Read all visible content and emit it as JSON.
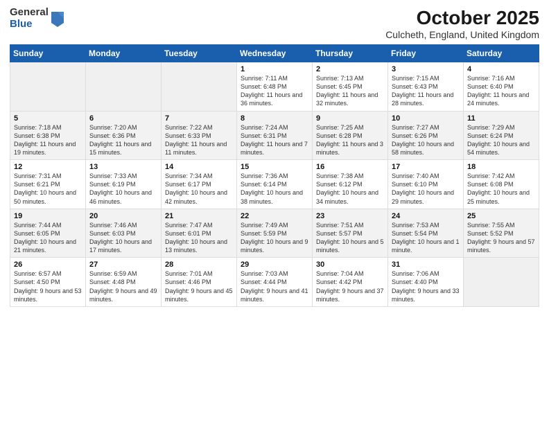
{
  "header": {
    "logo_general": "General",
    "logo_blue": "Blue",
    "title": "October 2025",
    "subtitle": "Culcheth, England, United Kingdom"
  },
  "days_of_week": [
    "Sunday",
    "Monday",
    "Tuesday",
    "Wednesday",
    "Thursday",
    "Friday",
    "Saturday"
  ],
  "weeks": [
    [
      {
        "day": "",
        "sunrise": "",
        "sunset": "",
        "daylight": ""
      },
      {
        "day": "",
        "sunrise": "",
        "sunset": "",
        "daylight": ""
      },
      {
        "day": "",
        "sunrise": "",
        "sunset": "",
        "daylight": ""
      },
      {
        "day": "1",
        "sunrise": "Sunrise: 7:11 AM",
        "sunset": "Sunset: 6:48 PM",
        "daylight": "Daylight: 11 hours and 36 minutes."
      },
      {
        "day": "2",
        "sunrise": "Sunrise: 7:13 AM",
        "sunset": "Sunset: 6:45 PM",
        "daylight": "Daylight: 11 hours and 32 minutes."
      },
      {
        "day": "3",
        "sunrise": "Sunrise: 7:15 AM",
        "sunset": "Sunset: 6:43 PM",
        "daylight": "Daylight: 11 hours and 28 minutes."
      },
      {
        "day": "4",
        "sunrise": "Sunrise: 7:16 AM",
        "sunset": "Sunset: 6:40 PM",
        "daylight": "Daylight: 11 hours and 24 minutes."
      }
    ],
    [
      {
        "day": "5",
        "sunrise": "Sunrise: 7:18 AM",
        "sunset": "Sunset: 6:38 PM",
        "daylight": "Daylight: 11 hours and 19 minutes."
      },
      {
        "day": "6",
        "sunrise": "Sunrise: 7:20 AM",
        "sunset": "Sunset: 6:36 PM",
        "daylight": "Daylight: 11 hours and 15 minutes."
      },
      {
        "day": "7",
        "sunrise": "Sunrise: 7:22 AM",
        "sunset": "Sunset: 6:33 PM",
        "daylight": "Daylight: 11 hours and 11 minutes."
      },
      {
        "day": "8",
        "sunrise": "Sunrise: 7:24 AM",
        "sunset": "Sunset: 6:31 PM",
        "daylight": "Daylight: 11 hours and 7 minutes."
      },
      {
        "day": "9",
        "sunrise": "Sunrise: 7:25 AM",
        "sunset": "Sunset: 6:28 PM",
        "daylight": "Daylight: 11 hours and 3 minutes."
      },
      {
        "day": "10",
        "sunrise": "Sunrise: 7:27 AM",
        "sunset": "Sunset: 6:26 PM",
        "daylight": "Daylight: 10 hours and 58 minutes."
      },
      {
        "day": "11",
        "sunrise": "Sunrise: 7:29 AM",
        "sunset": "Sunset: 6:24 PM",
        "daylight": "Daylight: 10 hours and 54 minutes."
      }
    ],
    [
      {
        "day": "12",
        "sunrise": "Sunrise: 7:31 AM",
        "sunset": "Sunset: 6:21 PM",
        "daylight": "Daylight: 10 hours and 50 minutes."
      },
      {
        "day": "13",
        "sunrise": "Sunrise: 7:33 AM",
        "sunset": "Sunset: 6:19 PM",
        "daylight": "Daylight: 10 hours and 46 minutes."
      },
      {
        "day": "14",
        "sunrise": "Sunrise: 7:34 AM",
        "sunset": "Sunset: 6:17 PM",
        "daylight": "Daylight: 10 hours and 42 minutes."
      },
      {
        "day": "15",
        "sunrise": "Sunrise: 7:36 AM",
        "sunset": "Sunset: 6:14 PM",
        "daylight": "Daylight: 10 hours and 38 minutes."
      },
      {
        "day": "16",
        "sunrise": "Sunrise: 7:38 AM",
        "sunset": "Sunset: 6:12 PM",
        "daylight": "Daylight: 10 hours and 34 minutes."
      },
      {
        "day": "17",
        "sunrise": "Sunrise: 7:40 AM",
        "sunset": "Sunset: 6:10 PM",
        "daylight": "Daylight: 10 hours and 29 minutes."
      },
      {
        "day": "18",
        "sunrise": "Sunrise: 7:42 AM",
        "sunset": "Sunset: 6:08 PM",
        "daylight": "Daylight: 10 hours and 25 minutes."
      }
    ],
    [
      {
        "day": "19",
        "sunrise": "Sunrise: 7:44 AM",
        "sunset": "Sunset: 6:05 PM",
        "daylight": "Daylight: 10 hours and 21 minutes."
      },
      {
        "day": "20",
        "sunrise": "Sunrise: 7:46 AM",
        "sunset": "Sunset: 6:03 PM",
        "daylight": "Daylight: 10 hours and 17 minutes."
      },
      {
        "day": "21",
        "sunrise": "Sunrise: 7:47 AM",
        "sunset": "Sunset: 6:01 PM",
        "daylight": "Daylight: 10 hours and 13 minutes."
      },
      {
        "day": "22",
        "sunrise": "Sunrise: 7:49 AM",
        "sunset": "Sunset: 5:59 PM",
        "daylight": "Daylight: 10 hours and 9 minutes."
      },
      {
        "day": "23",
        "sunrise": "Sunrise: 7:51 AM",
        "sunset": "Sunset: 5:57 PM",
        "daylight": "Daylight: 10 hours and 5 minutes."
      },
      {
        "day": "24",
        "sunrise": "Sunrise: 7:53 AM",
        "sunset": "Sunset: 5:54 PM",
        "daylight": "Daylight: 10 hours and 1 minute."
      },
      {
        "day": "25",
        "sunrise": "Sunrise: 7:55 AM",
        "sunset": "Sunset: 5:52 PM",
        "daylight": "Daylight: 9 hours and 57 minutes."
      }
    ],
    [
      {
        "day": "26",
        "sunrise": "Sunrise: 6:57 AM",
        "sunset": "Sunset: 4:50 PM",
        "daylight": "Daylight: 9 hours and 53 minutes."
      },
      {
        "day": "27",
        "sunrise": "Sunrise: 6:59 AM",
        "sunset": "Sunset: 4:48 PM",
        "daylight": "Daylight: 9 hours and 49 minutes."
      },
      {
        "day": "28",
        "sunrise": "Sunrise: 7:01 AM",
        "sunset": "Sunset: 4:46 PM",
        "daylight": "Daylight: 9 hours and 45 minutes."
      },
      {
        "day": "29",
        "sunrise": "Sunrise: 7:03 AM",
        "sunset": "Sunset: 4:44 PM",
        "daylight": "Daylight: 9 hours and 41 minutes."
      },
      {
        "day": "30",
        "sunrise": "Sunrise: 7:04 AM",
        "sunset": "Sunset: 4:42 PM",
        "daylight": "Daylight: 9 hours and 37 minutes."
      },
      {
        "day": "31",
        "sunrise": "Sunrise: 7:06 AM",
        "sunset": "Sunset: 4:40 PM",
        "daylight": "Daylight: 9 hours and 33 minutes."
      },
      {
        "day": "",
        "sunrise": "",
        "sunset": "",
        "daylight": ""
      }
    ]
  ]
}
